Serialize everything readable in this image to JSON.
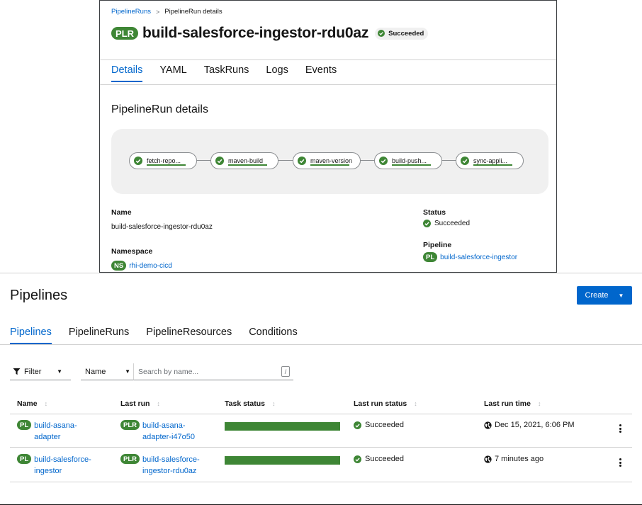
{
  "run_card": {
    "breadcrumb": {
      "parent": "PipelineRuns",
      "separator": ">",
      "current": "PipelineRun details"
    },
    "badge": "PLR",
    "title": "build-salesforce-ingestor-rdu0az",
    "status": "Succeeded",
    "tabs": [
      "Details",
      "YAML",
      "TaskRuns",
      "Logs",
      "Events"
    ],
    "active_tab": "Details",
    "section_title": "PipelineRun details",
    "tasks": [
      {
        "label": "fetch-repo..."
      },
      {
        "label": "maven-build"
      },
      {
        "label": "maven-version"
      },
      {
        "label": "build-push..."
      },
      {
        "label": "sync-appli..."
      }
    ],
    "details": {
      "name_label": "Name",
      "name_value": "build-salesforce-ingestor-rdu0az",
      "namespace_label": "Namespace",
      "namespace_badge": "NS",
      "namespace_value": "rhi-demo-cicd",
      "status_label": "Status",
      "status_value": "Succeeded",
      "pipeline_label": "Pipeline",
      "pipeline_badge": "PL",
      "pipeline_value": "build-salesforce-ingestor"
    }
  },
  "pipelines_page": {
    "title": "Pipelines",
    "create_label": "Create",
    "tabs": [
      "Pipelines",
      "PipelineRuns",
      "PipelineResources",
      "Conditions"
    ],
    "active_tab": "Pipelines",
    "filter_label": "Filter",
    "filter_by": "Name",
    "search_placeholder": "Search by name...",
    "search_shortcut": "/",
    "columns": [
      "Name",
      "Last run",
      "Task status",
      "Last run status",
      "Last run time"
    ],
    "rows": [
      {
        "name_badge": "PL",
        "name": [
          "build-asana-",
          "adapter"
        ],
        "last_run_badge": "PLR",
        "last_run": [
          "build-asana-",
          "adapter-i47o50"
        ],
        "task_status_complete": 1.0,
        "last_run_status": "Succeeded",
        "last_run_time": "Dec 15, 2021, 6:06 PM"
      },
      {
        "name_badge": "PL",
        "name": [
          "build-salesforce-",
          "ingestor"
        ],
        "last_run_badge": "PLR",
        "last_run": [
          "build-salesforce-",
          "ingestor-rdu0az"
        ],
        "task_status_complete": 1.0,
        "last_run_status": "Succeeded",
        "last_run_time": "7 minutes ago"
      }
    ]
  },
  "colors": {
    "accent": "#0066cc",
    "success": "#3e8635",
    "text": "#151515",
    "muted": "#6a6e73",
    "panel": "#f0f0f0"
  },
  "icons": {
    "status": "check-circle-icon",
    "time": "globe-icon",
    "filter": "filter-icon",
    "sort": "sort-icon",
    "actions": "kebab-icon"
  }
}
